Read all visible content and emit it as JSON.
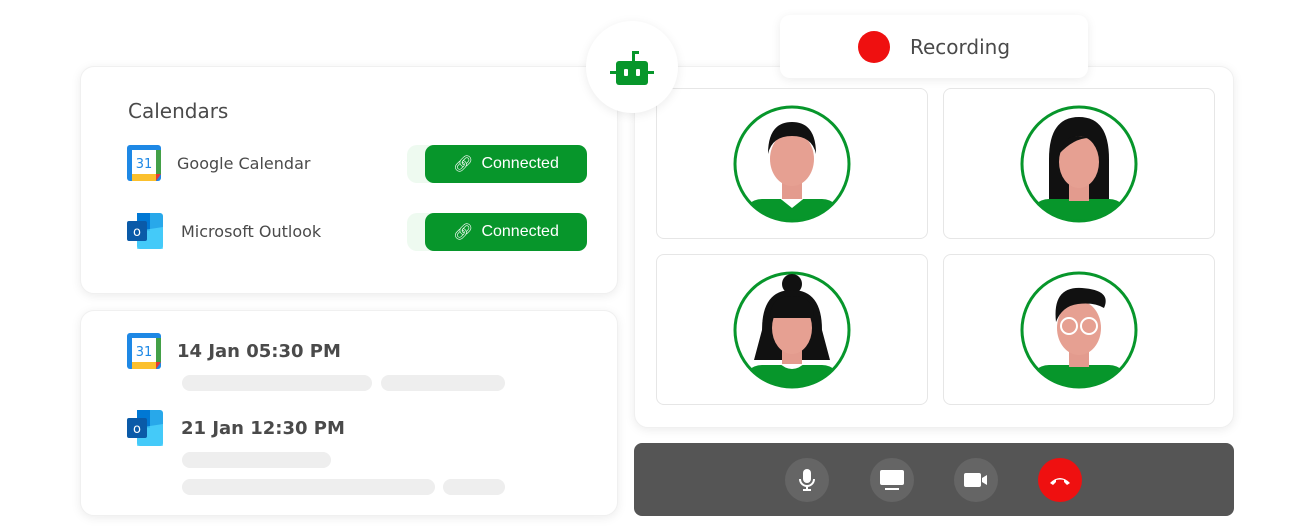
{
  "calendars": {
    "title": "Calendars",
    "items": [
      {
        "name": "Google Calendar",
        "icon": "google-calendar-icon",
        "status": "Connected"
      },
      {
        "name": "Microsoft Outlook",
        "icon": "outlook-icon",
        "status": "Connected"
      }
    ]
  },
  "schedule": {
    "events": [
      {
        "icon": "google-calendar-icon",
        "date": "14 Jan 05:30 PM"
      },
      {
        "icon": "outlook-icon",
        "date": "21 Jan 12:30 PM"
      }
    ]
  },
  "google_icon_text": "31",
  "outlook_icon_text": "o",
  "recording": {
    "label": "Recording",
    "color": "#ef1010"
  },
  "colors": {
    "accent": "#07962b",
    "end_call": "#ef1010",
    "control_bar": "#555555"
  },
  "controls": [
    "microphone-icon",
    "screen-share-icon",
    "camera-icon",
    "end-call-icon"
  ]
}
